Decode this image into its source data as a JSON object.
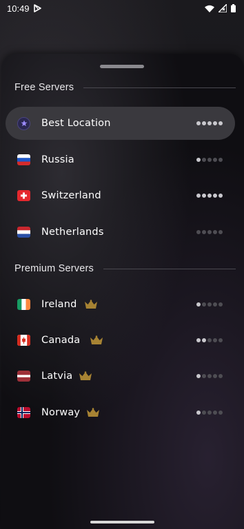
{
  "status_bar": {
    "time": "10:49"
  },
  "sections": {
    "free": {
      "title": "Free Servers"
    },
    "premium": {
      "title": "Premium Servers"
    }
  },
  "servers": {
    "best": {
      "name": "Best Location",
      "signal": 5
    },
    "russia": {
      "name": "Russia",
      "signal": 1
    },
    "switzerland": {
      "name": "Switzerland",
      "signal": 5
    },
    "netherlands": {
      "name": "Netherlands",
      "signal": 0
    },
    "ireland": {
      "name": "Ireland",
      "signal": 1
    },
    "canada": {
      "name": "Canada",
      "signal": 2
    },
    "latvia": {
      "name": "Latvia",
      "signal": 1
    },
    "norway": {
      "name": "Norway",
      "signal": 1
    }
  },
  "icons": {
    "star": "star-icon",
    "crown": "crown-icon",
    "play_store": "play-store-icon",
    "wifi": "wifi-icon",
    "cellular": "cellular-icon",
    "battery": "battery-icon"
  },
  "colors": {
    "selected_row": "#3a393e",
    "signal_on": "#c9c8cd",
    "signal_off": "#4e4d53",
    "crown": "#b08a3a"
  }
}
